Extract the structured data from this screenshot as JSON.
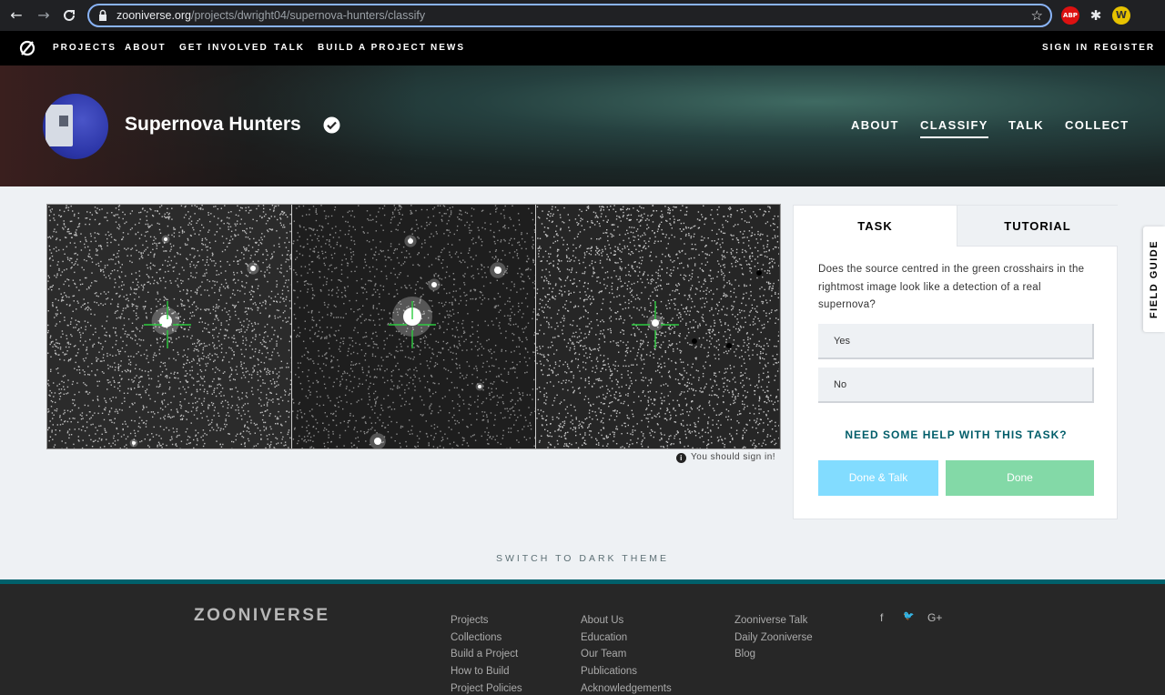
{
  "browser": {
    "url_host": "zooniverse.org",
    "url_path": "/projects/dwright04/supernova-hunters/classify",
    "ext_abp": "ABP",
    "ext_w": "W"
  },
  "topnav": {
    "items": [
      "PROJECTS",
      "ABOUT",
      "GET INVOLVED",
      "TALK",
      "BUILD A PROJECT",
      "NEWS"
    ],
    "sign_in": "SIGN IN",
    "register": "REGISTER"
  },
  "project": {
    "title": "Supernova Hunters",
    "nav": [
      "ABOUT",
      "CLASSIFY",
      "TALK",
      "COLLECT"
    ],
    "active_nav": "CLASSIFY"
  },
  "viewer": {
    "signin_note": "You should sign in!"
  },
  "task": {
    "tab_task": "TASK",
    "tab_tutorial": "TUTORIAL",
    "question": "Does the source centred in the green crosshairs in the rightmost image look like a detection of a real supernova?",
    "answers": [
      "Yes",
      "No"
    ],
    "help": "NEED SOME HELP WITH THIS TASK?",
    "done_talk": "Done & Talk",
    "done": "Done"
  },
  "field_guide": "FIELD GUIDE",
  "theme_switch": "SWITCH TO DARK THEME",
  "footer": {
    "logo": "ZOONIVERSE",
    "col1": [
      "Projects",
      "Collections",
      "Build a Project",
      "How to Build",
      "Project Policies"
    ],
    "col2": [
      "About Us",
      "Education",
      "Our Team",
      "Publications",
      "Acknowledgements"
    ],
    "col3": [
      "Zooniverse Talk",
      "Daily Zooniverse",
      "Blog"
    ],
    "social": [
      "f",
      "🐦",
      "G+"
    ]
  },
  "colors": {
    "accent": "#005d69",
    "done_talk": "#82dcff",
    "done": "#83d9a7",
    "crosshair": "#2ecc40"
  }
}
